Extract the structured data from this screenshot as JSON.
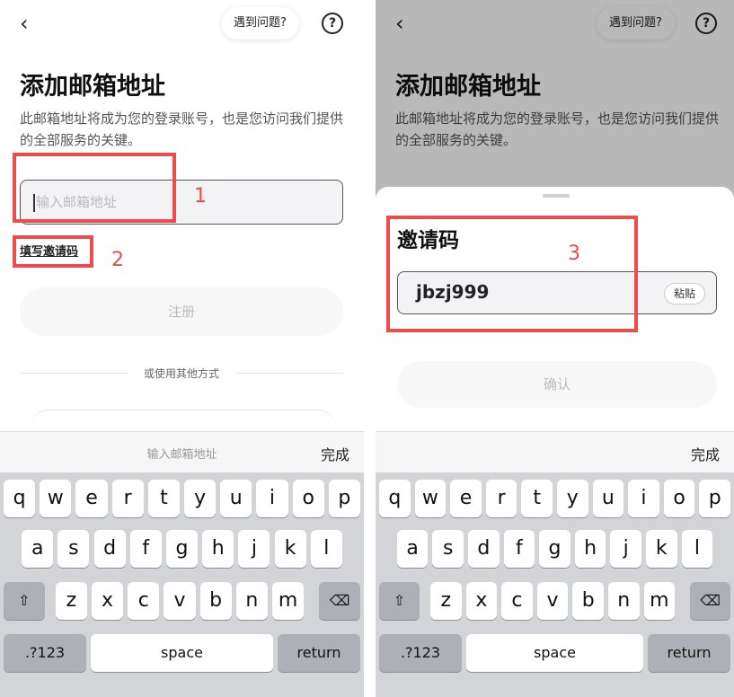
{
  "left": {
    "back_glyph": "‹",
    "help_label": "遇到问题?",
    "help_icon_glyph": "?",
    "title": "添加邮箱地址",
    "subtitle": "此邮箱地址将成为您的登录账号，也是您访问我们提供的全部服务的关键。",
    "email_placeholder": "输入邮箱地址",
    "invite_link": "填写邀请码",
    "register_button": "注册",
    "divider_text": "或使用其他方式",
    "keyboard_hint": "输入邮箱地址",
    "keyboard_done": "完成"
  },
  "right": {
    "back_glyph": "‹",
    "help_label": "遇到问题?",
    "help_icon_glyph": "?",
    "title": "添加邮箱地址",
    "subtitle": "此邮箱地址将成为您的登录账号，也是您访问我们提供的全部服务的关键。",
    "sheet_title": "邀请码",
    "invite_code_value": "jbzj999",
    "paste_button": "粘贴",
    "confirm_button": "确认",
    "keyboard_done": "完成"
  },
  "keyboard": {
    "row1": [
      "q",
      "w",
      "e",
      "r",
      "t",
      "y",
      "u",
      "i",
      "o",
      "p"
    ],
    "row2": [
      "a",
      "s",
      "d",
      "f",
      "g",
      "h",
      "j",
      "k",
      "l"
    ],
    "row3": [
      "z",
      "x",
      "c",
      "v",
      "b",
      "n",
      "m"
    ],
    "shift_glyph": "⇧",
    "delete_glyph": "⌫",
    "numbers_label": ".?123",
    "space_label": "space",
    "return_label": "return"
  },
  "annotations": {
    "one": "1",
    "two": "2",
    "three": "3",
    "color": "#ee4b4b"
  }
}
